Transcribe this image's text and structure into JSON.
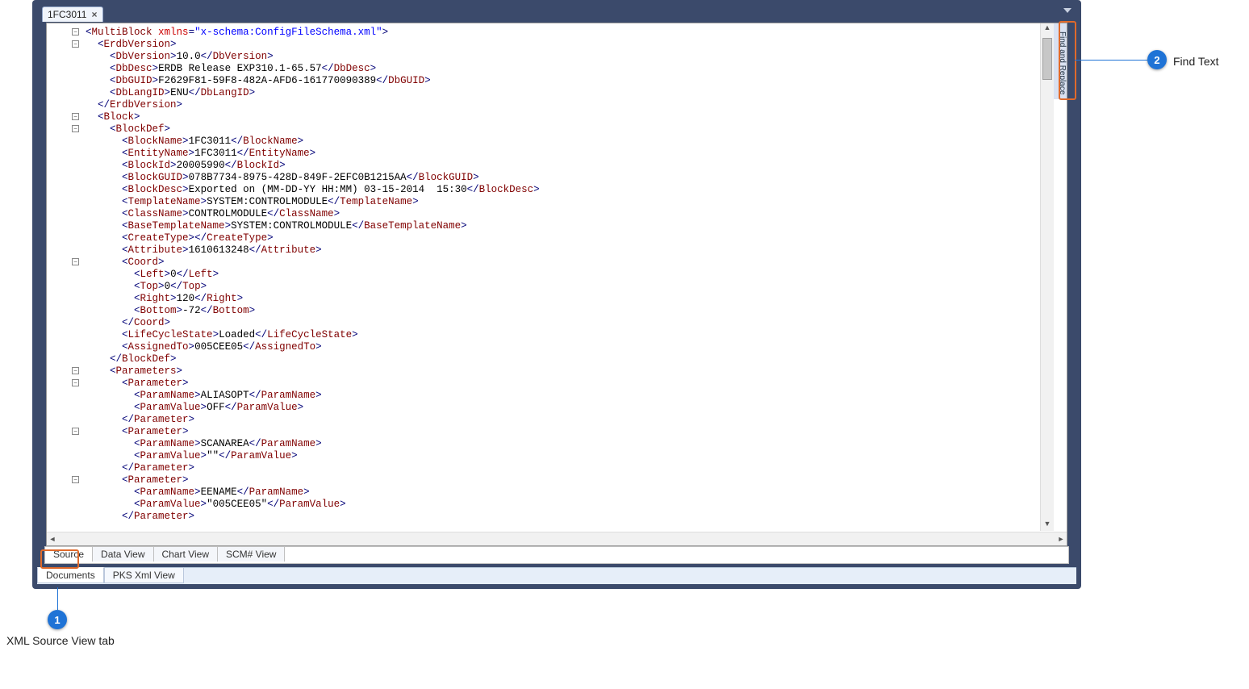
{
  "top_tab": {
    "label": "1FC3011"
  },
  "find_replace_label": "Find and Replace",
  "code_lines": [
    {
      "fold": true,
      "indent": 0,
      "segs": [
        {
          "k": "pn",
          "t": "<"
        },
        {
          "k": "tag",
          "t": "MultiBlock"
        },
        {
          "k": "txt",
          "t": " "
        },
        {
          "k": "attr",
          "t": "xmlns"
        },
        {
          "k": "pn",
          "t": "="
        },
        {
          "k": "attv",
          "t": "\"x-schema:ConfigFileSchema.xml\""
        },
        {
          "k": "pn",
          "t": ">"
        }
      ]
    },
    {
      "fold": true,
      "indent": 1,
      "segs": [
        {
          "k": "pn",
          "t": "<"
        },
        {
          "k": "tag",
          "t": "ErdbVersion"
        },
        {
          "k": "pn",
          "t": ">"
        }
      ]
    },
    {
      "fold": false,
      "indent": 2,
      "segs": [
        {
          "k": "pn",
          "t": "<"
        },
        {
          "k": "tag",
          "t": "DbVersion"
        },
        {
          "k": "pn",
          "t": ">"
        },
        {
          "k": "txt",
          "t": "10.0"
        },
        {
          "k": "pn",
          "t": "</"
        },
        {
          "k": "tag",
          "t": "DbVersion"
        },
        {
          "k": "pn",
          "t": ">"
        }
      ]
    },
    {
      "fold": false,
      "indent": 2,
      "segs": [
        {
          "k": "pn",
          "t": "<"
        },
        {
          "k": "tag",
          "t": "DbDesc"
        },
        {
          "k": "pn",
          "t": ">"
        },
        {
          "k": "txt",
          "t": "ERDB Release EXP310.1-65.57"
        },
        {
          "k": "pn",
          "t": "</"
        },
        {
          "k": "tag",
          "t": "DbDesc"
        },
        {
          "k": "pn",
          "t": ">"
        }
      ]
    },
    {
      "fold": false,
      "indent": 2,
      "segs": [
        {
          "k": "pn",
          "t": "<"
        },
        {
          "k": "tag",
          "t": "DbGUID"
        },
        {
          "k": "pn",
          "t": ">"
        },
        {
          "k": "txt",
          "t": "F2629F81-59F8-482A-AFD6-161770090389"
        },
        {
          "k": "pn",
          "t": "</"
        },
        {
          "k": "tag",
          "t": "DbGUID"
        },
        {
          "k": "pn",
          "t": ">"
        }
      ]
    },
    {
      "fold": false,
      "indent": 2,
      "segs": [
        {
          "k": "pn",
          "t": "<"
        },
        {
          "k": "tag",
          "t": "DbLangID"
        },
        {
          "k": "pn",
          "t": ">"
        },
        {
          "k": "txt",
          "t": "ENU"
        },
        {
          "k": "pn",
          "t": "</"
        },
        {
          "k": "tag",
          "t": "DbLangID"
        },
        {
          "k": "pn",
          "t": ">"
        }
      ]
    },
    {
      "fold": false,
      "indent": 1,
      "segs": [
        {
          "k": "pn",
          "t": "</"
        },
        {
          "k": "tag",
          "t": "ErdbVersion"
        },
        {
          "k": "pn",
          "t": ">"
        }
      ]
    },
    {
      "fold": true,
      "indent": 1,
      "segs": [
        {
          "k": "pn",
          "t": "<"
        },
        {
          "k": "tag",
          "t": "Block"
        },
        {
          "k": "pn",
          "t": ">"
        }
      ]
    },
    {
      "fold": true,
      "indent": 2,
      "segs": [
        {
          "k": "pn",
          "t": "<"
        },
        {
          "k": "tag",
          "t": "BlockDef"
        },
        {
          "k": "pn",
          "t": ">"
        }
      ]
    },
    {
      "fold": false,
      "indent": 3,
      "segs": [
        {
          "k": "pn",
          "t": "<"
        },
        {
          "k": "tag",
          "t": "BlockName"
        },
        {
          "k": "pn",
          "t": ">"
        },
        {
          "k": "txt",
          "t": "1FC3011"
        },
        {
          "k": "pn",
          "t": "</"
        },
        {
          "k": "tag",
          "t": "BlockName"
        },
        {
          "k": "pn",
          "t": ">"
        }
      ]
    },
    {
      "fold": false,
      "indent": 3,
      "segs": [
        {
          "k": "pn",
          "t": "<"
        },
        {
          "k": "tag",
          "t": "EntityName"
        },
        {
          "k": "pn",
          "t": ">"
        },
        {
          "k": "txt",
          "t": "1FC3011"
        },
        {
          "k": "pn",
          "t": "</"
        },
        {
          "k": "tag",
          "t": "EntityName"
        },
        {
          "k": "pn",
          "t": ">"
        }
      ]
    },
    {
      "fold": false,
      "indent": 3,
      "segs": [
        {
          "k": "pn",
          "t": "<"
        },
        {
          "k": "tag",
          "t": "BlockId"
        },
        {
          "k": "pn",
          "t": ">"
        },
        {
          "k": "txt",
          "t": "20005990"
        },
        {
          "k": "pn",
          "t": "</"
        },
        {
          "k": "tag",
          "t": "BlockId"
        },
        {
          "k": "pn",
          "t": ">"
        }
      ]
    },
    {
      "fold": false,
      "indent": 3,
      "segs": [
        {
          "k": "pn",
          "t": "<"
        },
        {
          "k": "tag",
          "t": "BlockGUID"
        },
        {
          "k": "pn",
          "t": ">"
        },
        {
          "k": "txt",
          "t": "078B7734-8975-428D-849F-2EFC0B1215AA"
        },
        {
          "k": "pn",
          "t": "</"
        },
        {
          "k": "tag",
          "t": "BlockGUID"
        },
        {
          "k": "pn",
          "t": ">"
        }
      ]
    },
    {
      "fold": false,
      "indent": 3,
      "segs": [
        {
          "k": "pn",
          "t": "<"
        },
        {
          "k": "tag",
          "t": "BlockDesc"
        },
        {
          "k": "pn",
          "t": ">"
        },
        {
          "k": "txt",
          "t": "Exported on (MM-DD-YY HH:MM) 03-15-2014  15:30"
        },
        {
          "k": "pn",
          "t": "</"
        },
        {
          "k": "tag",
          "t": "BlockDesc"
        },
        {
          "k": "pn",
          "t": ">"
        }
      ]
    },
    {
      "fold": false,
      "indent": 3,
      "segs": [
        {
          "k": "pn",
          "t": "<"
        },
        {
          "k": "tag",
          "t": "TemplateName"
        },
        {
          "k": "pn",
          "t": ">"
        },
        {
          "k": "txt",
          "t": "SYSTEM:CONTROLMODULE"
        },
        {
          "k": "pn",
          "t": "</"
        },
        {
          "k": "tag",
          "t": "TemplateName"
        },
        {
          "k": "pn",
          "t": ">"
        }
      ]
    },
    {
      "fold": false,
      "indent": 3,
      "segs": [
        {
          "k": "pn",
          "t": "<"
        },
        {
          "k": "tag",
          "t": "ClassName"
        },
        {
          "k": "pn",
          "t": ">"
        },
        {
          "k": "txt",
          "t": "CONTROLMODULE"
        },
        {
          "k": "pn",
          "t": "</"
        },
        {
          "k": "tag",
          "t": "ClassName"
        },
        {
          "k": "pn",
          "t": ">"
        }
      ]
    },
    {
      "fold": false,
      "indent": 3,
      "segs": [
        {
          "k": "pn",
          "t": "<"
        },
        {
          "k": "tag",
          "t": "BaseTemplateName"
        },
        {
          "k": "pn",
          "t": ">"
        },
        {
          "k": "txt",
          "t": "SYSTEM:CONTROLMODULE"
        },
        {
          "k": "pn",
          "t": "</"
        },
        {
          "k": "tag",
          "t": "BaseTemplateName"
        },
        {
          "k": "pn",
          "t": ">"
        }
      ]
    },
    {
      "fold": false,
      "indent": 3,
      "segs": [
        {
          "k": "pn",
          "t": "<"
        },
        {
          "k": "tag",
          "t": "CreateType"
        },
        {
          "k": "pn",
          "t": ">"
        },
        {
          "k": "pn",
          "t": "</"
        },
        {
          "k": "tag",
          "t": "CreateType"
        },
        {
          "k": "pn",
          "t": ">"
        }
      ]
    },
    {
      "fold": false,
      "indent": 3,
      "segs": [
        {
          "k": "pn",
          "t": "<"
        },
        {
          "k": "tag",
          "t": "Attribute"
        },
        {
          "k": "pn",
          "t": ">"
        },
        {
          "k": "txt",
          "t": "1610613248"
        },
        {
          "k": "pn",
          "t": "</"
        },
        {
          "k": "tag",
          "t": "Attribute"
        },
        {
          "k": "pn",
          "t": ">"
        }
      ]
    },
    {
      "fold": true,
      "indent": 3,
      "segs": [
        {
          "k": "pn",
          "t": "<"
        },
        {
          "k": "tag",
          "t": "Coord"
        },
        {
          "k": "pn",
          "t": ">"
        }
      ]
    },
    {
      "fold": false,
      "indent": 4,
      "segs": [
        {
          "k": "pn",
          "t": "<"
        },
        {
          "k": "tag",
          "t": "Left"
        },
        {
          "k": "pn",
          "t": ">"
        },
        {
          "k": "txt",
          "t": "0"
        },
        {
          "k": "pn",
          "t": "</"
        },
        {
          "k": "tag",
          "t": "Left"
        },
        {
          "k": "pn",
          "t": ">"
        }
      ]
    },
    {
      "fold": false,
      "indent": 4,
      "segs": [
        {
          "k": "pn",
          "t": "<"
        },
        {
          "k": "tag",
          "t": "Top"
        },
        {
          "k": "pn",
          "t": ">"
        },
        {
          "k": "txt",
          "t": "0"
        },
        {
          "k": "pn",
          "t": "</"
        },
        {
          "k": "tag",
          "t": "Top"
        },
        {
          "k": "pn",
          "t": ">"
        }
      ]
    },
    {
      "fold": false,
      "indent": 4,
      "segs": [
        {
          "k": "pn",
          "t": "<"
        },
        {
          "k": "tag",
          "t": "Right"
        },
        {
          "k": "pn",
          "t": ">"
        },
        {
          "k": "txt",
          "t": "120"
        },
        {
          "k": "pn",
          "t": "</"
        },
        {
          "k": "tag",
          "t": "Right"
        },
        {
          "k": "pn",
          "t": ">"
        }
      ]
    },
    {
      "fold": false,
      "indent": 4,
      "segs": [
        {
          "k": "pn",
          "t": "<"
        },
        {
          "k": "tag",
          "t": "Bottom"
        },
        {
          "k": "pn",
          "t": ">"
        },
        {
          "k": "txt",
          "t": "-72"
        },
        {
          "k": "pn",
          "t": "</"
        },
        {
          "k": "tag",
          "t": "Bottom"
        },
        {
          "k": "pn",
          "t": ">"
        }
      ]
    },
    {
      "fold": false,
      "indent": 3,
      "segs": [
        {
          "k": "pn",
          "t": "</"
        },
        {
          "k": "tag",
          "t": "Coord"
        },
        {
          "k": "pn",
          "t": ">"
        }
      ]
    },
    {
      "fold": false,
      "indent": 3,
      "segs": [
        {
          "k": "pn",
          "t": "<"
        },
        {
          "k": "tag",
          "t": "LifeCycleState"
        },
        {
          "k": "pn",
          "t": ">"
        },
        {
          "k": "txt",
          "t": "Loaded"
        },
        {
          "k": "pn",
          "t": "</"
        },
        {
          "k": "tag",
          "t": "LifeCycleState"
        },
        {
          "k": "pn",
          "t": ">"
        }
      ]
    },
    {
      "fold": false,
      "indent": 3,
      "segs": [
        {
          "k": "pn",
          "t": "<"
        },
        {
          "k": "tag",
          "t": "AssignedTo"
        },
        {
          "k": "pn",
          "t": ">"
        },
        {
          "k": "txt",
          "t": "005CEE05"
        },
        {
          "k": "pn",
          "t": "</"
        },
        {
          "k": "tag",
          "t": "AssignedTo"
        },
        {
          "k": "pn",
          "t": ">"
        }
      ]
    },
    {
      "fold": false,
      "indent": 2,
      "segs": [
        {
          "k": "pn",
          "t": "</"
        },
        {
          "k": "tag",
          "t": "BlockDef"
        },
        {
          "k": "pn",
          "t": ">"
        }
      ]
    },
    {
      "fold": true,
      "indent": 2,
      "segs": [
        {
          "k": "pn",
          "t": "<"
        },
        {
          "k": "tag",
          "t": "Parameters"
        },
        {
          "k": "pn",
          "t": ">"
        }
      ]
    },
    {
      "fold": true,
      "indent": 3,
      "segs": [
        {
          "k": "pn",
          "t": "<"
        },
        {
          "k": "tag",
          "t": "Parameter"
        },
        {
          "k": "pn",
          "t": ">"
        }
      ]
    },
    {
      "fold": false,
      "indent": 4,
      "segs": [
        {
          "k": "pn",
          "t": "<"
        },
        {
          "k": "tag",
          "t": "ParamName"
        },
        {
          "k": "pn",
          "t": ">"
        },
        {
          "k": "txt",
          "t": "ALIASOPT"
        },
        {
          "k": "pn",
          "t": "</"
        },
        {
          "k": "tag",
          "t": "ParamName"
        },
        {
          "k": "pn",
          "t": ">"
        }
      ]
    },
    {
      "fold": false,
      "indent": 4,
      "segs": [
        {
          "k": "pn",
          "t": "<"
        },
        {
          "k": "tag",
          "t": "ParamValue"
        },
        {
          "k": "pn",
          "t": ">"
        },
        {
          "k": "txt",
          "t": "OFF"
        },
        {
          "k": "pn",
          "t": "</"
        },
        {
          "k": "tag",
          "t": "ParamValue"
        },
        {
          "k": "pn",
          "t": ">"
        }
      ]
    },
    {
      "fold": false,
      "indent": 3,
      "segs": [
        {
          "k": "pn",
          "t": "</"
        },
        {
          "k": "tag",
          "t": "Parameter"
        },
        {
          "k": "pn",
          "t": ">"
        }
      ]
    },
    {
      "fold": true,
      "indent": 3,
      "segs": [
        {
          "k": "pn",
          "t": "<"
        },
        {
          "k": "tag",
          "t": "Parameter"
        },
        {
          "k": "pn",
          "t": ">"
        }
      ]
    },
    {
      "fold": false,
      "indent": 4,
      "segs": [
        {
          "k": "pn",
          "t": "<"
        },
        {
          "k": "tag",
          "t": "ParamName"
        },
        {
          "k": "pn",
          "t": ">"
        },
        {
          "k": "txt",
          "t": "SCANAREA"
        },
        {
          "k": "pn",
          "t": "</"
        },
        {
          "k": "tag",
          "t": "ParamName"
        },
        {
          "k": "pn",
          "t": ">"
        }
      ]
    },
    {
      "fold": false,
      "indent": 4,
      "segs": [
        {
          "k": "pn",
          "t": "<"
        },
        {
          "k": "tag",
          "t": "ParamValue"
        },
        {
          "k": "pn",
          "t": ">"
        },
        {
          "k": "txt",
          "t": "\"\""
        },
        {
          "k": "pn",
          "t": "</"
        },
        {
          "k": "tag",
          "t": "ParamValue"
        },
        {
          "k": "pn",
          "t": ">"
        }
      ]
    },
    {
      "fold": false,
      "indent": 3,
      "segs": [
        {
          "k": "pn",
          "t": "</"
        },
        {
          "k": "tag",
          "t": "Parameter"
        },
        {
          "k": "pn",
          "t": ">"
        }
      ]
    },
    {
      "fold": true,
      "indent": 3,
      "segs": [
        {
          "k": "pn",
          "t": "<"
        },
        {
          "k": "tag",
          "t": "Parameter"
        },
        {
          "k": "pn",
          "t": ">"
        }
      ]
    },
    {
      "fold": false,
      "indent": 4,
      "segs": [
        {
          "k": "pn",
          "t": "<"
        },
        {
          "k": "tag",
          "t": "ParamName"
        },
        {
          "k": "pn",
          "t": ">"
        },
        {
          "k": "txt",
          "t": "EENAME"
        },
        {
          "k": "pn",
          "t": "</"
        },
        {
          "k": "tag",
          "t": "ParamName"
        },
        {
          "k": "pn",
          "t": ">"
        }
      ]
    },
    {
      "fold": false,
      "indent": 4,
      "segs": [
        {
          "k": "pn",
          "t": "<"
        },
        {
          "k": "tag",
          "t": "ParamValue"
        },
        {
          "k": "pn",
          "t": ">"
        },
        {
          "k": "txt",
          "t": "\"005CEE05\""
        },
        {
          "k": "pn",
          "t": "</"
        },
        {
          "k": "tag",
          "t": "ParamValue"
        },
        {
          "k": "pn",
          "t": ">"
        }
      ]
    },
    {
      "fold": false,
      "indent": 3,
      "segs": [
        {
          "k": "pn",
          "t": "</"
        },
        {
          "k": "tag",
          "t": "Parameter"
        },
        {
          "k": "pn",
          "t": ">"
        }
      ]
    }
  ],
  "view_tabs": [
    "Source",
    "Data View",
    "Chart View",
    "SCM# View"
  ],
  "view_tabs_active_index": 0,
  "doc_tabs": [
    "Documents",
    "PKS Xml View"
  ],
  "doc_tabs_active_index": 0,
  "callouts": {
    "c1": {
      "num": "1",
      "text": "XML Source View tab"
    },
    "c2": {
      "num": "2",
      "text": "Find Text"
    }
  }
}
